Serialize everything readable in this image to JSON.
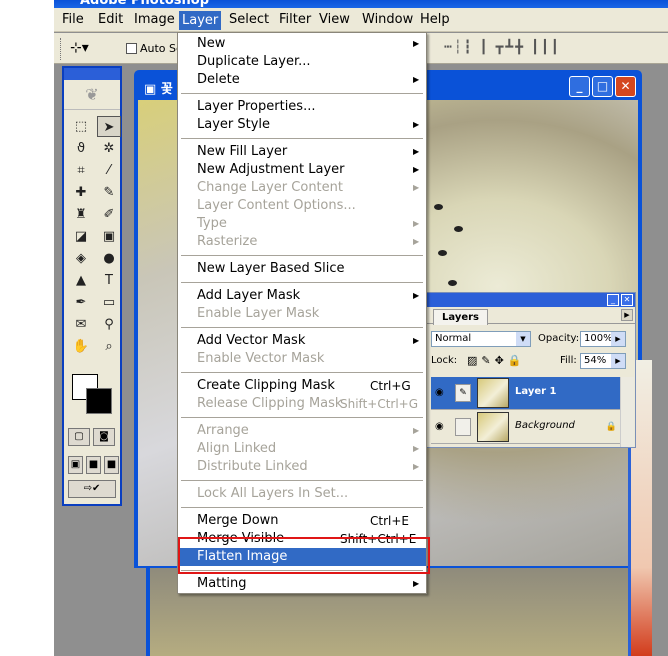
{
  "app": {
    "title": "Adobe Photoshop"
  },
  "menubar": [
    {
      "label": "File",
      "key": "file"
    },
    {
      "label": "Edit",
      "key": "edit"
    },
    {
      "label": "Image",
      "key": "image"
    },
    {
      "label": "Layer",
      "key": "layer",
      "active": true
    },
    {
      "label": "Select",
      "key": "select"
    },
    {
      "label": "Filter",
      "key": "filter"
    },
    {
      "label": "View",
      "key": "view"
    },
    {
      "label": "Window",
      "key": "window"
    },
    {
      "label": "Help",
      "key": "help"
    }
  ],
  "options_bar": {
    "auto_select_label": "Auto Se"
  },
  "document": {
    "title": "꽃"
  },
  "layer_menu": {
    "items": [
      {
        "label": "New",
        "enabled": true,
        "submenu": true
      },
      {
        "label": "Duplicate Layer...",
        "enabled": true
      },
      {
        "label": "Delete",
        "enabled": true,
        "submenu": true
      },
      {
        "separator": true
      },
      {
        "label": "Layer Properties...",
        "enabled": true
      },
      {
        "label": "Layer Style",
        "enabled": true,
        "submenu": true
      },
      {
        "separator": true
      },
      {
        "label": "New Fill Layer",
        "enabled": true,
        "submenu": true
      },
      {
        "label": "New Adjustment Layer",
        "enabled": true,
        "submenu": true
      },
      {
        "label": "Change Layer Content",
        "enabled": false,
        "submenu": true
      },
      {
        "label": "Layer Content Options...",
        "enabled": false
      },
      {
        "label": "Type",
        "enabled": false,
        "submenu": true
      },
      {
        "label": "Rasterize",
        "enabled": false,
        "submenu": true
      },
      {
        "separator": true
      },
      {
        "label": "New Layer Based Slice",
        "enabled": true
      },
      {
        "separator": true
      },
      {
        "label": "Add Layer Mask",
        "enabled": true,
        "submenu": true
      },
      {
        "label": "Enable Layer Mask",
        "enabled": false
      },
      {
        "separator": true
      },
      {
        "label": "Add Vector Mask",
        "enabled": true,
        "submenu": true
      },
      {
        "label": "Enable Vector Mask",
        "enabled": false
      },
      {
        "separator": true
      },
      {
        "label": "Create Clipping Mask",
        "shortcut": "Ctrl+G",
        "enabled": true
      },
      {
        "label": "Release Clipping Mask",
        "shortcut": "Shift+Ctrl+G",
        "enabled": false
      },
      {
        "separator": true
      },
      {
        "label": "Arrange",
        "enabled": false,
        "submenu": true
      },
      {
        "label": "Align Linked",
        "enabled": false,
        "submenu": true
      },
      {
        "label": "Distribute Linked",
        "enabled": false,
        "submenu": true
      },
      {
        "separator": true
      },
      {
        "label": "Lock All Layers In Set...",
        "enabled": false
      },
      {
        "separator": true
      },
      {
        "label": "Merge Down",
        "shortcut": "Ctrl+E",
        "enabled": true
      },
      {
        "label": "Merge Visible",
        "shortcut": "Shift+Ctrl+E",
        "enabled": true
      },
      {
        "label": "Flatten Image",
        "enabled": true,
        "highlighted": true
      },
      {
        "separator": true
      },
      {
        "label": "Matting",
        "enabled": true,
        "submenu": true
      }
    ]
  },
  "layers_panel": {
    "tab": "Layers",
    "blend_mode": "Normal",
    "opacity_label": "Opacity:",
    "opacity": "100%",
    "lock_label": "Lock:",
    "fill_label": "Fill:",
    "fill": "54%",
    "layers": [
      {
        "name": "Layer 1",
        "selected": true
      },
      {
        "name": "Background",
        "selected": false,
        "locked": true
      }
    ]
  },
  "colors": {
    "accent": "#316ac5",
    "highlight_box": "#e01616",
    "title_blue": "#0a52d8"
  }
}
